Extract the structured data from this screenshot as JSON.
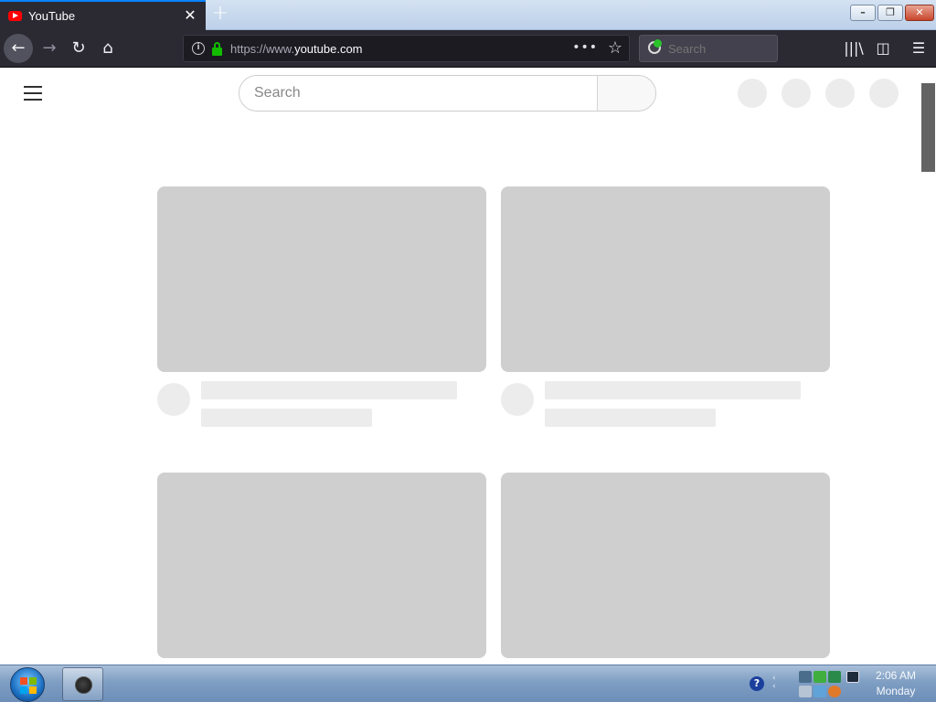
{
  "browser": {
    "tab": {
      "title": "YouTube",
      "close_glyph": "✕"
    },
    "new_tab_glyph": "+",
    "window_controls": {
      "minimize": "–",
      "restore": "❐",
      "close": "✕"
    },
    "nav": {
      "back": "←",
      "forward": "→",
      "reload": "↻",
      "home": "⌂"
    },
    "url": {
      "prefix": "https://www.",
      "domain": "youtube.com"
    },
    "page_actions_glyph": "•••",
    "bookmark_glyph": "☆",
    "search_placeholder": "Search",
    "library_glyph": "|||\\",
    "sidebar_glyph": "◫",
    "menu_glyph": "☰"
  },
  "youtube": {
    "search_placeholder": "Search",
    "header_buttons": [
      "apps-button",
      "messages-button",
      "notifications-button",
      "account-button"
    ],
    "cards": 4
  },
  "taskbar": {
    "help_glyph": "?",
    "clock": {
      "time": "2:06 AM",
      "day": "Monday"
    }
  },
  "colors": {
    "firefox_dark": "#2b2a33",
    "skeleton_thumb": "#cfcfcf",
    "skeleton_line": "#ececec",
    "youtube_red": "#ff0000",
    "secure_lock": "#12bc00"
  }
}
